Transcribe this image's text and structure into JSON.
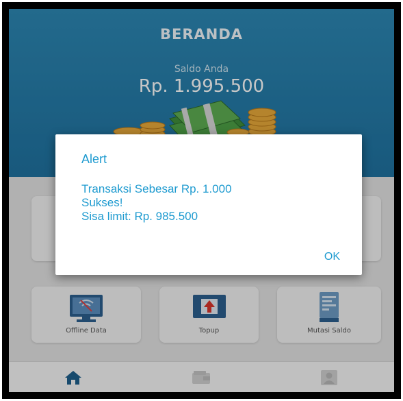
{
  "header": {
    "title": "BERANDA",
    "balance_label": "Saldo Anda",
    "balance_value": "Rp. 1.995.500"
  },
  "menu": {
    "items": [
      {
        "label": "Offline Data",
        "icon": "offline-data-icon"
      },
      {
        "label": "Topup",
        "icon": "topup-icon"
      },
      {
        "label": "Mutasi Saldo",
        "icon": "mutasi-saldo-icon"
      }
    ]
  },
  "nav": {
    "items": [
      {
        "icon": "home-icon",
        "active": true
      },
      {
        "icon": "wallet-icon",
        "active": false
      },
      {
        "icon": "profile-icon",
        "active": false
      }
    ]
  },
  "dialog": {
    "title": "Alert",
    "message_line1": "Transaksi Sebesar Rp. 1.000",
    "message_line2": "Sukses!",
    "message_line3": "Sisa limit: Rp. 985.500",
    "ok_label": "OK"
  },
  "colors": {
    "header": "#2a82b0",
    "accent": "#1f9bd0",
    "home_icon": "#1e5f8c"
  }
}
